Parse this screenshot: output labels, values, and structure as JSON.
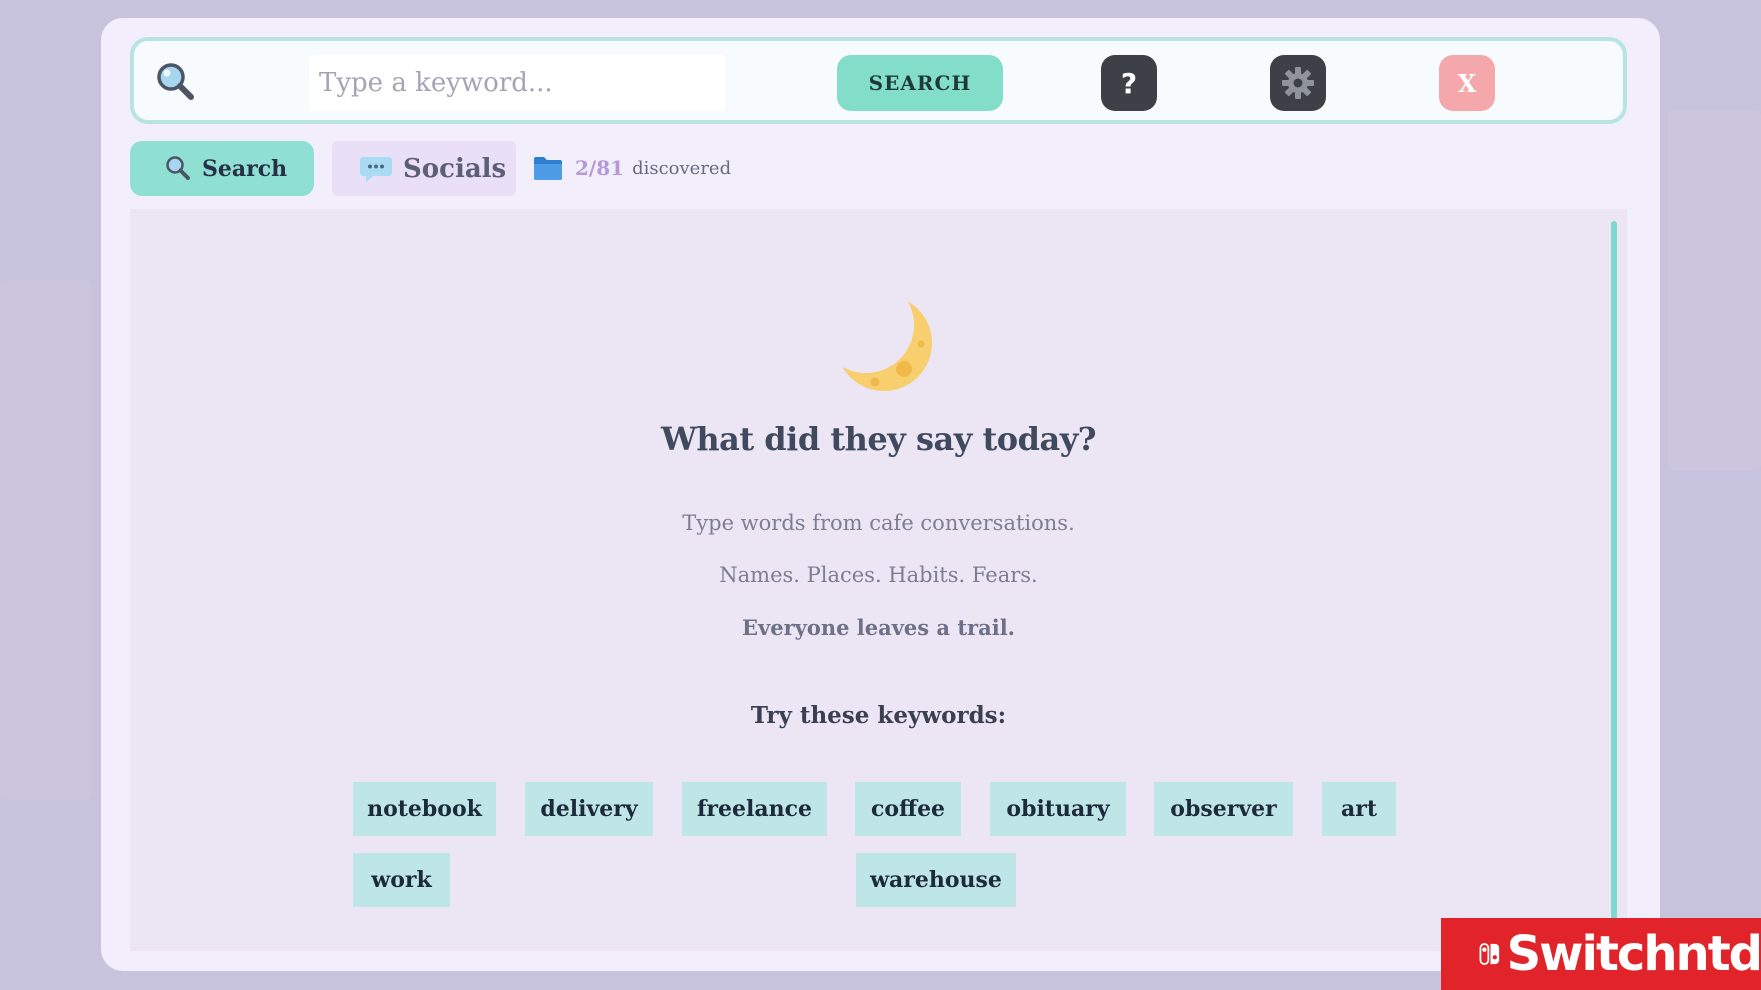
{
  "search_bar": {
    "placeholder": "Type a keyword...",
    "search_label": "SEARCH",
    "help_label": "?",
    "close_label": "X"
  },
  "tabs": [
    {
      "label": "Search",
      "icon": "search-icon",
      "active": true
    },
    {
      "label": "Socials",
      "icon": "chat-bubble-icon",
      "active": false
    }
  ],
  "discovered": {
    "count": "2/81",
    "label": "discovered",
    "icon": "folder-icon"
  },
  "main": {
    "icon": "crescent-moon-icon",
    "headline": "What did they say today?",
    "line1": "Type words from cafe conversations.",
    "line2": "Names. Places. Habits. Fears.",
    "line3": "Everyone leaves a trail.",
    "try_label": "Try these keywords:",
    "keywords": [
      "notebook",
      "delivery",
      "freelance",
      "coffee",
      "obituary",
      "observer",
      "art",
      "work",
      "warehouse"
    ]
  },
  "watermark": {
    "brand": "Switchntd"
  },
  "colors": {
    "accent": "#82ddc9",
    "dark_button": "#3d4147",
    "close_button": "#f5a8ab",
    "keyword_chip": "#bfe6e6",
    "moon": "#f7cf6e",
    "brand_red": "#e0242a"
  }
}
